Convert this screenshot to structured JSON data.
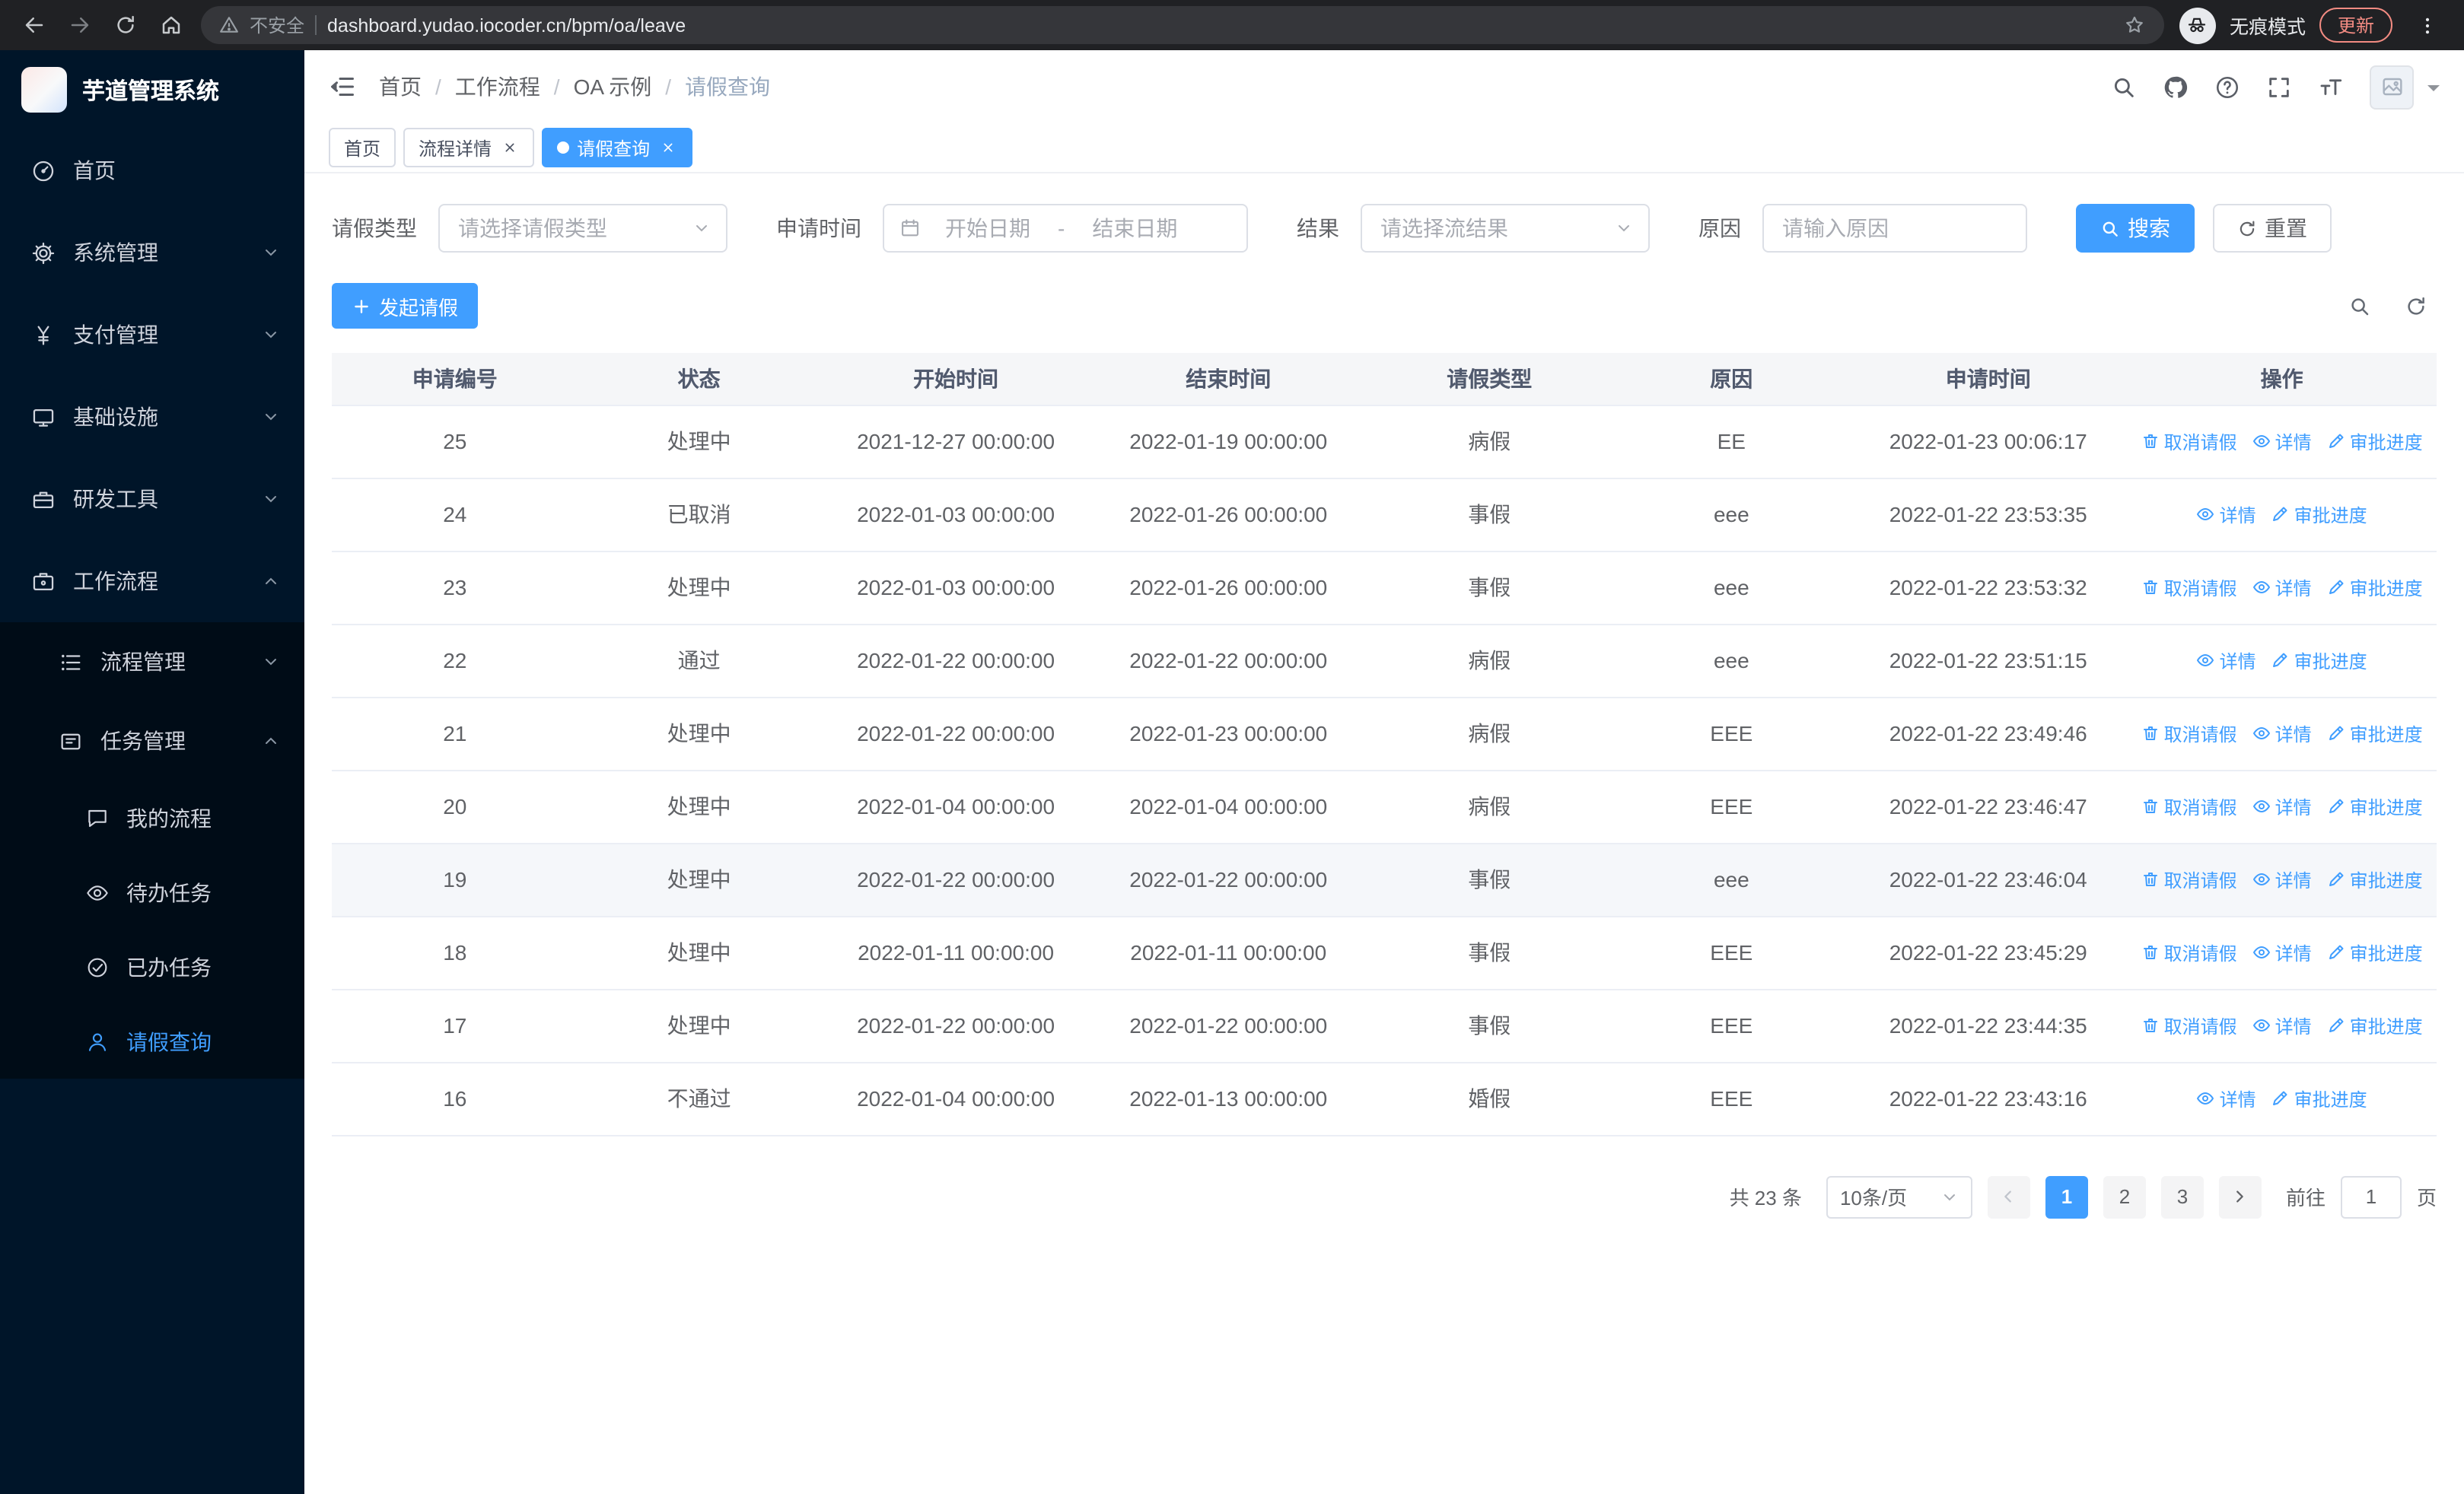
{
  "browser": {
    "security_label": "不安全",
    "url": "dashboard.yudao.iocoder.cn/bpm/oa/leave",
    "incognito_label": "无痕模式",
    "update_label": "更新"
  },
  "sidebar": {
    "logo_title": "芋道管理系统",
    "items": [
      {
        "label": "首页"
      },
      {
        "label": "系统管理"
      },
      {
        "label": "支付管理"
      },
      {
        "label": "基础设施"
      },
      {
        "label": "研发工具"
      },
      {
        "label": "工作流程"
      }
    ],
    "process_mgmt_label": "流程管理",
    "task_mgmt_label": "任务管理",
    "task_items": [
      {
        "label": "我的流程"
      },
      {
        "label": "待办任务"
      },
      {
        "label": "已办任务"
      },
      {
        "label": "请假查询"
      }
    ]
  },
  "header": {
    "breadcrumb": {
      "separator": "/",
      "items": [
        "首页",
        "工作流程",
        "OA 示例",
        "请假查询"
      ]
    }
  },
  "tabs": [
    {
      "label": "首页",
      "closable": false,
      "active": false
    },
    {
      "label": "流程详情",
      "closable": true,
      "active": false
    },
    {
      "label": "请假查询",
      "closable": true,
      "active": true
    }
  ],
  "filters": {
    "leave_type": {
      "label": "请假类型",
      "placeholder": "请选择请假类型"
    },
    "apply_time": {
      "label": "申请时间",
      "start_placeholder": "开始日期",
      "separator": "-",
      "end_placeholder": "结束日期"
    },
    "result": {
      "label": "结果",
      "placeholder": "请选择流结果"
    },
    "reason": {
      "label": "原因",
      "placeholder": "请输入原因"
    },
    "search_label": "搜索",
    "reset_label": "重置"
  },
  "toolbar": {
    "create_label": "发起请假"
  },
  "table": {
    "columns": [
      "申请编号",
      "状态",
      "开始时间",
      "结束时间",
      "请假类型",
      "原因",
      "申请时间",
      "操作"
    ],
    "col_keys": [
      "id",
      "status",
      "start",
      "end",
      "type",
      "reason",
      "applied"
    ],
    "action_labels": {
      "cancel": "取消请假",
      "detail": "详情",
      "progress": "审批进度"
    },
    "rows": [
      {
        "id": "25",
        "status": "处理中",
        "start": "2021-12-27 00:00:00",
        "end": "2022-01-19 00:00:00",
        "type": "病假",
        "reason": "EE",
        "applied": "2022-01-23 00:06:17",
        "actions": [
          "cancel",
          "detail",
          "progress"
        ],
        "hover": false
      },
      {
        "id": "24",
        "status": "已取消",
        "start": "2022-01-03 00:00:00",
        "end": "2022-01-26 00:00:00",
        "type": "事假",
        "reason": "eee",
        "applied": "2022-01-22 23:53:35",
        "actions": [
          "detail",
          "progress"
        ],
        "hover": false
      },
      {
        "id": "23",
        "status": "处理中",
        "start": "2022-01-03 00:00:00",
        "end": "2022-01-26 00:00:00",
        "type": "事假",
        "reason": "eee",
        "applied": "2022-01-22 23:53:32",
        "actions": [
          "cancel",
          "detail",
          "progress"
        ],
        "hover": false
      },
      {
        "id": "22",
        "status": "通过",
        "start": "2022-01-22 00:00:00",
        "end": "2022-01-22 00:00:00",
        "type": "病假",
        "reason": "eee",
        "applied": "2022-01-22 23:51:15",
        "actions": [
          "detail",
          "progress"
        ],
        "hover": false
      },
      {
        "id": "21",
        "status": "处理中",
        "start": "2022-01-22 00:00:00",
        "end": "2022-01-23 00:00:00",
        "type": "病假",
        "reason": "EEE",
        "applied": "2022-01-22 23:49:46",
        "actions": [
          "cancel",
          "detail",
          "progress"
        ],
        "hover": false
      },
      {
        "id": "20",
        "status": "处理中",
        "start": "2022-01-04 00:00:00",
        "end": "2022-01-04 00:00:00",
        "type": "病假",
        "reason": "EEE",
        "applied": "2022-01-22 23:46:47",
        "actions": [
          "cancel",
          "detail",
          "progress"
        ],
        "hover": false
      },
      {
        "id": "19",
        "status": "处理中",
        "start": "2022-01-22 00:00:00",
        "end": "2022-01-22 00:00:00",
        "type": "事假",
        "reason": "eee",
        "applied": "2022-01-22 23:46:04",
        "actions": [
          "cancel",
          "detail",
          "progress"
        ],
        "hover": true
      },
      {
        "id": "18",
        "status": "处理中",
        "start": "2022-01-11 00:00:00",
        "end": "2022-01-11 00:00:00",
        "type": "事假",
        "reason": "EEE",
        "applied": "2022-01-22 23:45:29",
        "actions": [
          "cancel",
          "detail",
          "progress"
        ],
        "hover": false
      },
      {
        "id": "17",
        "status": "处理中",
        "start": "2022-01-22 00:00:00",
        "end": "2022-01-22 00:00:00",
        "type": "事假",
        "reason": "EEE",
        "applied": "2022-01-22 23:44:35",
        "actions": [
          "cancel",
          "detail",
          "progress"
        ],
        "hover": false
      },
      {
        "id": "16",
        "status": "不通过",
        "start": "2022-01-04 00:00:00",
        "end": "2022-01-13 00:00:00",
        "type": "婚假",
        "reason": "EEE",
        "applied": "2022-01-22 23:43:16",
        "actions": [
          "detail",
          "progress"
        ],
        "hover": false
      }
    ]
  },
  "pagination": {
    "total_label": "共 23 条",
    "page_size_label": "10条/页",
    "pages": [
      "1",
      "2",
      "3"
    ],
    "active_page": "1",
    "goto_label": "前往",
    "goto_value": "1",
    "unit_label": "页"
  },
  "colors": {
    "accent": "#409eff",
    "sidebar_bg": "#001529",
    "chrome_bg": "#202124"
  }
}
